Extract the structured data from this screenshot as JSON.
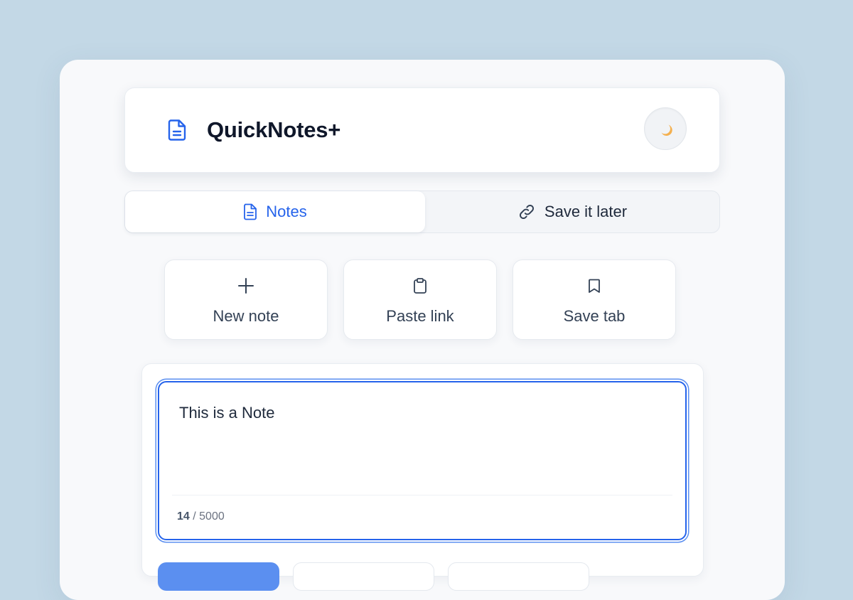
{
  "app": {
    "title": "QuickNotes+",
    "accent_color": "#2563eb",
    "theme_toggle_icon": "moon-icon"
  },
  "tabs": [
    {
      "label": "Notes",
      "icon": "document-icon",
      "active": true
    },
    {
      "label": "Save it later",
      "icon": "link-icon",
      "active": false
    }
  ],
  "actions": [
    {
      "label": "New note",
      "icon": "plus-icon"
    },
    {
      "label": "Paste link",
      "icon": "clipboard-icon"
    },
    {
      "label": "Save tab",
      "icon": "bookmark-icon"
    }
  ],
  "editor": {
    "value": "This is a Note",
    "char_count": "14",
    "char_limit": "/ 5000"
  }
}
